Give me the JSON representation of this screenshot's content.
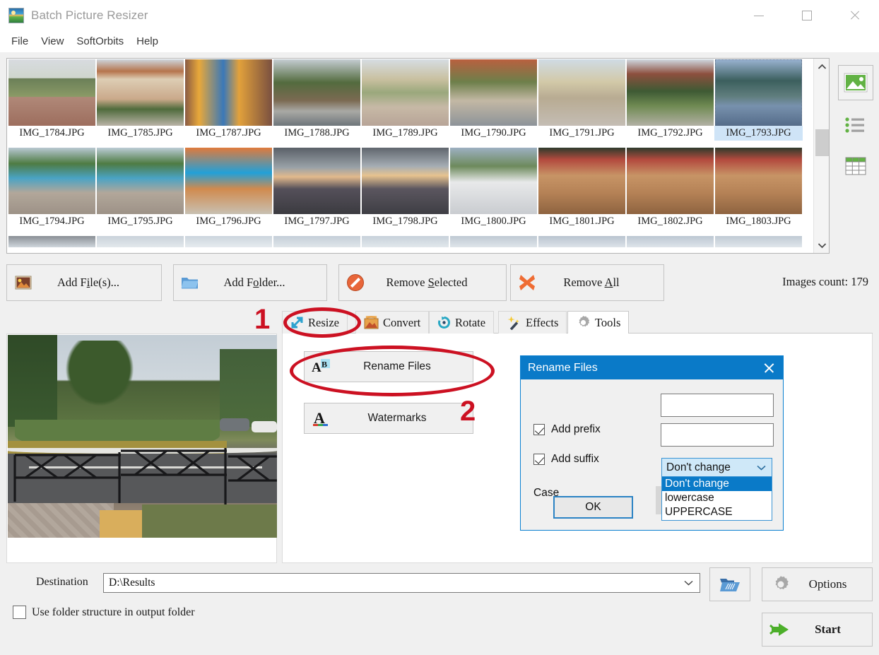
{
  "window": {
    "title": "Batch Picture Resizer",
    "icon": "app-logo-icon",
    "controls": {
      "minimize": "minimize-icon",
      "maximize": "maximize-icon",
      "close": "close-icon"
    }
  },
  "menu": {
    "items": [
      "File",
      "View",
      "SoftOrbits",
      "Help"
    ]
  },
  "thumbnails": {
    "rows": [
      [
        {
          "name": "IMG_1784.JPG",
          "selected": false
        },
        {
          "name": "IMG_1785.JPG",
          "selected": false
        },
        {
          "name": "IMG_1787.JPG",
          "selected": false
        },
        {
          "name": "IMG_1788.JPG",
          "selected": false
        },
        {
          "name": "IMG_1789.JPG",
          "selected": false
        },
        {
          "name": "IMG_1790.JPG",
          "selected": false
        },
        {
          "name": "IMG_1791.JPG",
          "selected": false
        },
        {
          "name": "IMG_1792.JPG",
          "selected": false
        },
        {
          "name": "IMG_1793.JPG",
          "selected": true
        }
      ],
      [
        {
          "name": "IMG_1794.JPG",
          "selected": false
        },
        {
          "name": "IMG_1795.JPG",
          "selected": false
        },
        {
          "name": "IMG_1796.JPG",
          "selected": false
        },
        {
          "name": "IMG_1797.JPG",
          "selected": false
        },
        {
          "name": "IMG_1798.JPG",
          "selected": false
        },
        {
          "name": "IMG_1800.JPG",
          "selected": false
        },
        {
          "name": "IMG_1801.JPG",
          "selected": false
        },
        {
          "name": "IMG_1802.JPG",
          "selected": false
        },
        {
          "name": "IMG_1803.JPG",
          "selected": false
        }
      ]
    ],
    "scrollbar": {
      "up": "chevron-up-icon",
      "down": "chevron-down-icon"
    }
  },
  "view_modes": [
    {
      "name": "thumbnails-view",
      "icon": "picture-icon",
      "active": true
    },
    {
      "name": "list-view",
      "icon": "list-icon",
      "active": false
    },
    {
      "name": "details-view",
      "icon": "grid-icon",
      "active": false
    }
  ],
  "file_actions": {
    "add_files": {
      "label": "Add File(s)...",
      "accel": "i",
      "icon": "picture-add-icon"
    },
    "add_folder": {
      "label": "Add Folder...",
      "accel": "o",
      "icon": "folder-icon"
    },
    "remove_selected": {
      "label": "Remove Selected",
      "accel": "S",
      "icon": "no-entry-icon"
    },
    "remove_all": {
      "label": "Remove All",
      "accel": "A",
      "icon": "red-x-icon"
    },
    "images_count": "Images count: 179"
  },
  "tabs": [
    {
      "label": "Resize",
      "icon": "resize-arrows-icon",
      "active": false
    },
    {
      "label": "Convert",
      "icon": "convert-icon",
      "active": false
    },
    {
      "label": "Rotate",
      "icon": "rotate-icon",
      "active": false
    },
    {
      "label": "Effects",
      "icon": "magic-wand-icon",
      "active": false
    },
    {
      "label": "Tools",
      "icon": "gear-icon",
      "active": true
    }
  ],
  "tools_pane": {
    "rename_files": {
      "label": "Rename Files",
      "icon": "ab-rename-icon"
    },
    "watermarks": {
      "label": "Watermarks",
      "icon": "letter-a-icon"
    }
  },
  "rename_dialog": {
    "title": "Rename Files",
    "close_icon": "close-icon",
    "add_prefix": {
      "label": "Add prefix",
      "checked": true,
      "value": ""
    },
    "add_suffix": {
      "label": "Add suffix",
      "checked": true,
      "value": ""
    },
    "case": {
      "label": "Case",
      "selected": "Don't change",
      "options": [
        "Don't change",
        "lowercase",
        "UPPERCASE"
      ],
      "open": true
    },
    "ok": "OK"
  },
  "bottom": {
    "destination_label": "Destination",
    "destination_value": "D:\\Results",
    "browse_icon": "open-folder-icon",
    "use_folder_structure": {
      "label": "Use folder structure in output folder",
      "checked": false
    },
    "options": {
      "label": "Options",
      "icon": "gear-icon"
    },
    "start": {
      "label": "Start",
      "icon": "green-arrow-icon"
    }
  },
  "annotations": [
    {
      "number": "1",
      "target": "Resize tab"
    },
    {
      "number": "2",
      "target": "Rename Files button"
    }
  ],
  "colors": {
    "accent": "#0a7ac8",
    "annotation_red": "#cc1122",
    "window_bg": "#f0f0f0",
    "button_bg": "#f0f0f0",
    "green": "#6aba45"
  }
}
